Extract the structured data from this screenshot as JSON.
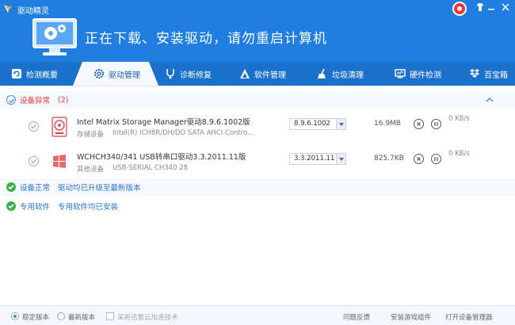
{
  "app": {
    "name": "驱动精灵",
    "banner": "正在下载、安装驱动，请勿重启计算机"
  },
  "colors": {
    "header": "#1f7ee0",
    "tabbar": "#1b70cc",
    "danger": "#e4393c",
    "ok": "#3ab04a",
    "link": "#2a74c8"
  },
  "tabs": [
    {
      "label": "检测概要",
      "icon": "refresh-icon"
    },
    {
      "label": "驱动管理",
      "icon": "gear-icon",
      "active": true
    },
    {
      "label": "诊断修复",
      "icon": "stethoscope-icon"
    },
    {
      "label": "软件管理",
      "icon": "triangle-logo-icon"
    },
    {
      "label": "垃圾清理",
      "icon": "broom-icon"
    },
    {
      "label": "硬件检测",
      "icon": "monitor-icon"
    },
    {
      "label": "百宝箱",
      "icon": "dropbox-icon"
    }
  ],
  "abnormal": {
    "title": "设备异常",
    "count": "(2)"
  },
  "drivers": [
    {
      "name": "Intel Matrix Storage Manager驱动8.9.6.1002版",
      "category": "存储设备",
      "desc": "Intel(R) ICH8R/DH/DO SATA AHCI Contro...",
      "version": "8.9.6.1002",
      "size": "16.9MB",
      "speed": "0 KB/s",
      "icon": "hard-disk-icon"
    },
    {
      "name": "WCHCH340/341 USB转串口驱动3.3.2011.11版",
      "category": "其他设备",
      "desc": "USB-SERIAL CH340   28",
      "version": "3.3.2011.11",
      "size": "825.7KB",
      "speed": "0 KB/s",
      "icon": "windows-logo-icon"
    }
  ],
  "normal": {
    "title": "设备正常",
    "sub": "驱动均已升级至最新版本"
  },
  "software": {
    "title": "专用软件",
    "sub": "专用软件均已安装"
  },
  "footer": {
    "stable": "稳定版本",
    "latest": "最新版本",
    "cloud": "采用迅雷云加速技术",
    "feedback": "问题反馈",
    "game": "安装游戏组件",
    "devmgr": "打开设备管理器"
  }
}
